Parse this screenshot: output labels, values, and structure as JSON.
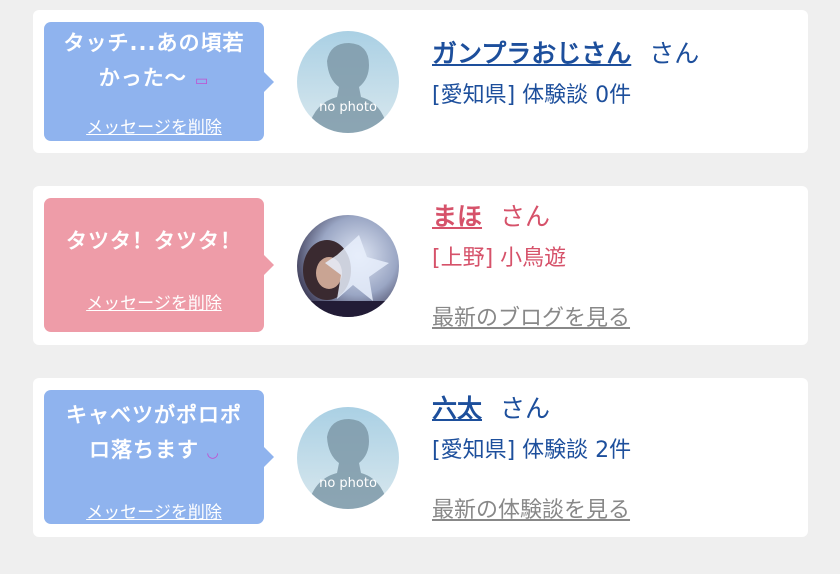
{
  "cards": [
    {
      "message_line1": "タッチ...あの頃若",
      "message_line2": "かった〜",
      "emoji": "▭",
      "delete_label": "メッセージを削除",
      "name": "ガンプラおじさん",
      "honorific": "さん",
      "detail": "[愛知県] 体験談 0件",
      "avatar": "no-photo",
      "avatar_text": "no photo"
    },
    {
      "message_line1": "タツタ！タツタ！",
      "delete_label": "メッセージを削除",
      "name": "まほ",
      "honorific": "さん",
      "detail": "[上野] 小鳥遊",
      "link_label": "最新のブログを見る",
      "avatar": "photo"
    },
    {
      "message_line1": "キャベツがポロポ",
      "message_line2": "ロ落ちます",
      "emoji": "◡",
      "delete_label": "メッセージを削除",
      "name": "六太",
      "honorific": "さん",
      "detail": "[愛知県] 体験談 2件",
      "link_label": "最新の体験談を見る",
      "avatar": "no-photo",
      "avatar_text": "no photo"
    }
  ],
  "colors": {
    "blue_bubble": "#8fb3ee",
    "pink_bubble": "#ee9ca8",
    "name_blue": "#1d4f9c",
    "name_pink": "#d6526a",
    "link_gray": "#888888"
  }
}
